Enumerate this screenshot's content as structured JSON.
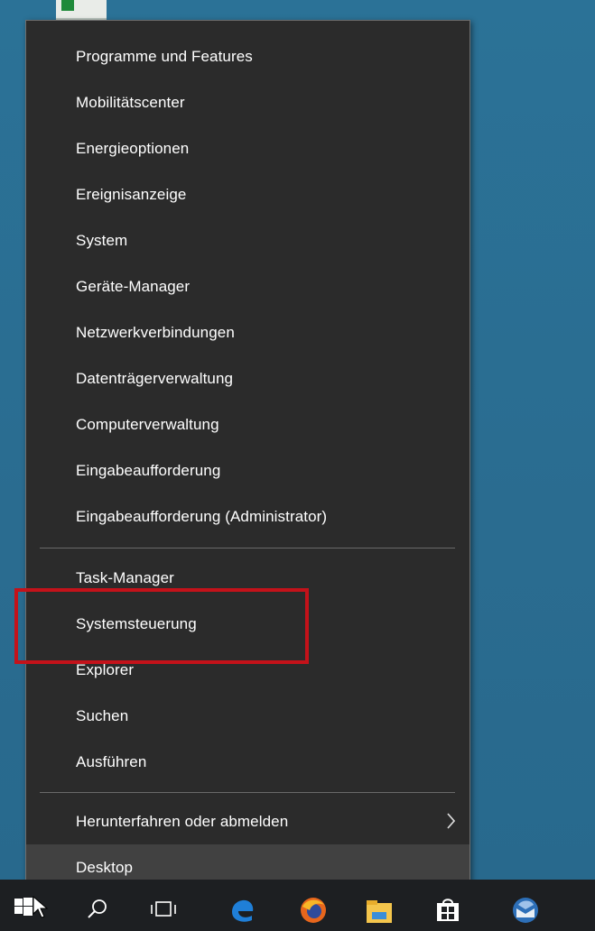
{
  "menu": {
    "group1": [
      {
        "label": "Programme und Features"
      },
      {
        "label": "Mobilitätscenter"
      },
      {
        "label": "Energieoptionen"
      },
      {
        "label": "Ereignisanzeige"
      },
      {
        "label": "System"
      },
      {
        "label": "Geräte-Manager"
      },
      {
        "label": "Netzwerkverbindungen"
      },
      {
        "label": "Datenträgerverwaltung"
      },
      {
        "label": "Computerverwaltung"
      },
      {
        "label": "Eingabeaufforderung"
      },
      {
        "label": "Eingabeaufforderung (Administrator)"
      }
    ],
    "group2": [
      {
        "label": "Task-Manager"
      },
      {
        "label": "Systemsteuerung"
      },
      {
        "label": "Explorer"
      },
      {
        "label": "Suchen"
      },
      {
        "label": "Ausführen"
      }
    ],
    "group3": [
      {
        "label": "Herunterfahren oder abmelden",
        "submenu_icon": "chevron-right-icon"
      },
      {
        "label": "Desktop"
      }
    ]
  },
  "highlight": {
    "target": "Systemsteuerung",
    "color": "#c4121a"
  },
  "taskbar": {
    "icons": [
      "windows-start-icon",
      "search-icon",
      "task-view-icon",
      "edge-icon",
      "firefox-icon",
      "file-explorer-icon",
      "store-icon",
      "thunderbird-icon"
    ]
  },
  "colors": {
    "menu_background": "#2b2b2b",
    "menu_text": "#ffffff",
    "hover_background": "#414141",
    "desktop_background": "#2b7297",
    "taskbar_background": "#1d1f22"
  }
}
